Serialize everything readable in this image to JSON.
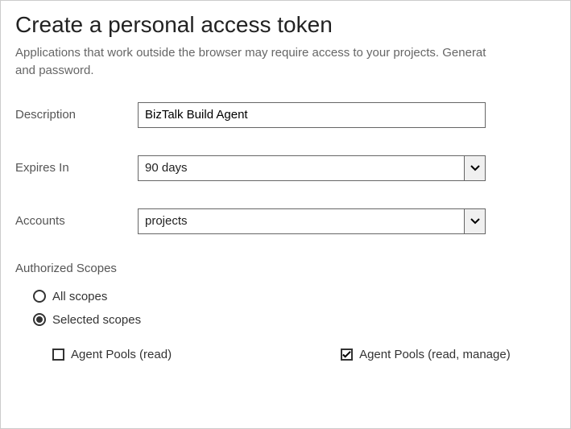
{
  "title": "Create a personal access token",
  "subtitle_line1": "Applications that work outside the browser may require access to your projects. Generat",
  "subtitle_line2": "and password.",
  "fields": {
    "description": {
      "label": "Description",
      "value": "BizTalk Build Agent"
    },
    "expires": {
      "label": "Expires In",
      "value": "90 days"
    },
    "accounts": {
      "label": "Accounts",
      "value": "projects"
    }
  },
  "scopes": {
    "heading": "Authorized Scopes",
    "options": {
      "all": "All scopes",
      "selected": "Selected scopes"
    },
    "selected_option": "selected",
    "checkboxes": {
      "read": {
        "label": "Agent Pools (read)",
        "checked": false
      },
      "manage": {
        "label": "Agent Pools (read, manage)",
        "checked": true
      }
    }
  }
}
